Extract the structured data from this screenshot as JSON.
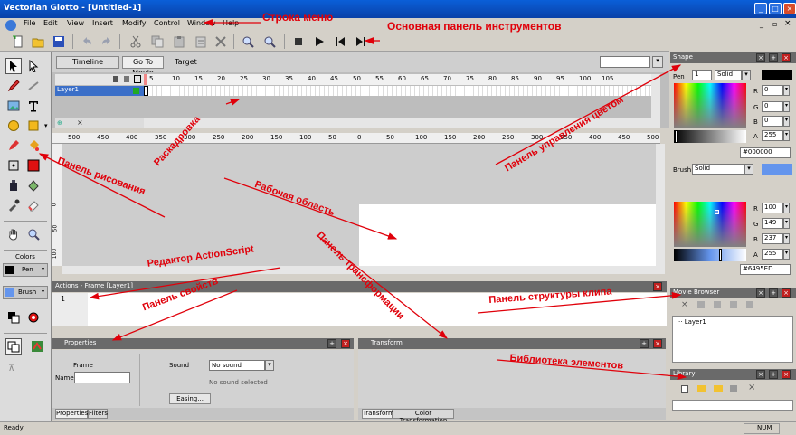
{
  "window": {
    "title": "Vectorian Giotto - [Untitled-1]"
  },
  "menu": {
    "items": [
      "File",
      "Edit",
      "View",
      "Insert",
      "Modify",
      "Control",
      "Window",
      "Help"
    ]
  },
  "timeline": {
    "tab_timeline": "Timeline",
    "tab_goto_movie": "Go To Movie",
    "target_label": "Target",
    "layer_name": "Layer1",
    "frame_numbers": [
      "1",
      "5",
      "10",
      "15",
      "20",
      "25",
      "30",
      "35",
      "40",
      "45",
      "50",
      "55",
      "60",
      "65",
      "70",
      "75",
      "80",
      "85",
      "90",
      "95",
      "100",
      "105"
    ]
  },
  "ruler": {
    "top_numbers": [
      "500",
      "450",
      "400",
      "350",
      "300",
      "250",
      "200",
      "150",
      "100",
      "50",
      "0",
      "50",
      "100",
      "150",
      "200",
      "250",
      "300",
      "350",
      "400",
      "450",
      "500"
    ],
    "left_numbers": [
      "0",
      "50",
      "100"
    ]
  },
  "colors": {
    "title": "Colors",
    "pen_label": "Pen",
    "brush_label": "Brush"
  },
  "actions": {
    "title": "Actions - Frame [Layer1]",
    "line_number": "1"
  },
  "properties": {
    "title": "Properties",
    "frame_label": "Frame",
    "name_label": "Name",
    "sound_label": "Sound",
    "sound_value": "No sound",
    "sound_status": "No sound selected",
    "easing_button": "Easing...",
    "tab_properties": "Properties",
    "tab_filters": "Filters"
  },
  "transform": {
    "title": "Transform",
    "tab_transform": "Transform",
    "tab_color_transform": "Color Transformation"
  },
  "shape": {
    "title": "Shape",
    "pen_label": "Pen",
    "pen_width": "1",
    "pen_style": "Solid",
    "pen_r": "0",
    "pen_g": "0",
    "pen_b": "0",
    "pen_a": "255",
    "pen_hex": "#000000",
    "brush_label": "Brush",
    "brush_style": "Solid",
    "brush_r": "100",
    "brush_g": "149",
    "brush_b": "237",
    "brush_a": "255",
    "brush_hex": "#6495ED",
    "r_label": "R",
    "g_label": "G",
    "b_label": "B",
    "a_label": "A"
  },
  "movie_browser": {
    "title": "Movie Browser",
    "item": "Layer1"
  },
  "library": {
    "title": "Library"
  },
  "status": {
    "left": "Ready",
    "right": "NUM"
  },
  "annotations": {
    "menu_bar": "Строка меню",
    "main_toolbar": "Основная панель инструментов",
    "storyboard": "Раскадровка",
    "color_panel": "Панель управления цветом",
    "drawing_panel": "Панель рисования",
    "work_area": "Рабочая область",
    "transform_panel": "Панель трансформации",
    "actionscript_editor": "Редактор ActionScript",
    "properties_panel": "Панель свойств",
    "clip_structure_panel": "Панель структуры клипа",
    "element_library": "Библиотека элементов"
  },
  "palette": {
    "annotation": "#e0000a",
    "titlebar": "#0a5fd8",
    "brush_color": "#6495ED",
    "pen_color": "#000000",
    "canvas": "#ffffff",
    "stage": "#cdcdcd"
  }
}
